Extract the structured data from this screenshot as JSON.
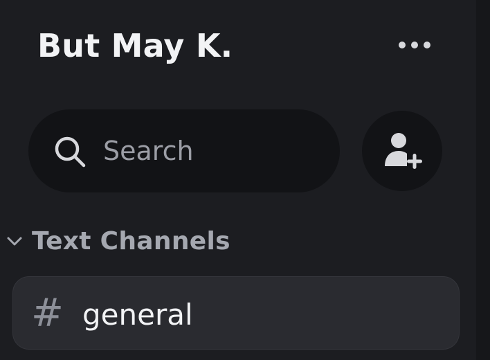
{
  "server": {
    "name": "But May K.",
    "more_icon": "ellipsis-horizontal-icon"
  },
  "search": {
    "placeholder": "Search",
    "value": "",
    "icon": "search-icon"
  },
  "add_friend": {
    "icon": "add-user-icon"
  },
  "channels": {
    "category_label": "Text Channels",
    "category_icon": "chevron-down-icon",
    "items": [
      {
        "name": "general",
        "icon": "hash-icon",
        "symbol": "#"
      }
    ]
  },
  "colors": {
    "background": "#1c1d21",
    "input_background": "#121316",
    "selected_channel": "#2a2b30",
    "title_text": "#f2f3f5",
    "muted_text": "#a5a8b0"
  }
}
